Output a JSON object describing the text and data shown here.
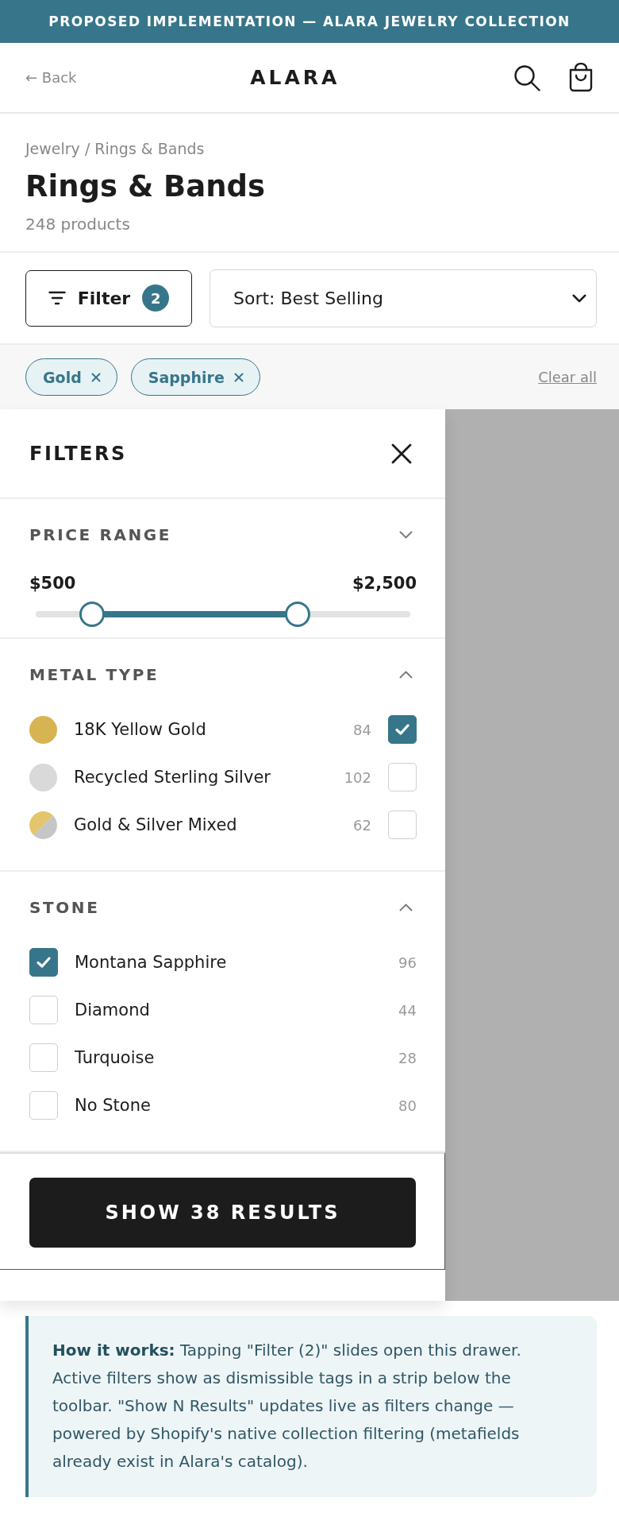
{
  "banner": {
    "text": "PROPOSED IMPLEMENTATION — ALARA JEWELRY COLLECTION"
  },
  "header": {
    "back": "← Back",
    "logo": "ALARA"
  },
  "collection": {
    "breadcrumb": "Jewelry / Rings & Bands",
    "title": "Rings & Bands",
    "count": "248 products"
  },
  "toolbar": {
    "filter_button": {
      "label": "Filter",
      "badge": "2"
    },
    "sort": {
      "value": "Sort: Best Selling"
    }
  },
  "active_filters": {
    "tags": [
      {
        "label": "Gold"
      },
      {
        "label": "Sapphire"
      }
    ],
    "clear_all": "Clear all"
  },
  "drawer": {
    "title": "FILTERS",
    "sections": [
      {
        "kind": "range",
        "title": "PRICE RANGE",
        "expanded": false,
        "min_label": "$500",
        "max_label": "$2,500",
        "thumbs": [
          {
            "level": 0.15
          },
          {
            "level": 0.7
          }
        ]
      },
      {
        "kind": "swatch_list",
        "title": "METAL TYPE",
        "expanded": true,
        "options": [
          {
            "label": "18K Yellow Gold",
            "count": "84",
            "checked": true,
            "swatch": [
              {
                "color": "#d6b452"
              }
            ]
          },
          {
            "label": "Recycled Sterling Silver",
            "count": "102",
            "checked": false,
            "swatch": [
              {
                "color": "#d9d9d9"
              }
            ]
          },
          {
            "label": "Gold & Silver Mixed",
            "count": "62",
            "checked": false,
            "swatch": [
              {
                "color": "#e3c56c"
              },
              {
                "color": "#c6c6c6"
              }
            ]
          }
        ]
      },
      {
        "kind": "checkbox_list",
        "title": "STONE",
        "expanded": true,
        "options": [
          {
            "label": "Montana Sapphire",
            "count": "96",
            "checked": true
          },
          {
            "label": "Diamond",
            "count": "44",
            "checked": false
          },
          {
            "label": "Turquoise",
            "count": "28",
            "checked": false
          },
          {
            "label": "No Stone",
            "count": "80",
            "checked": false
          }
        ]
      }
    ],
    "apply_button": "SHOW 38 RESULTS"
  },
  "note": {
    "text": "**How it works:** Tapping \"Filter (2)\" slides open this drawer. Active filters show as dismissible tags in a strip below the toolbar. \"Show N Results\" updates live as filters change — powered by Shopify's native collection filtering (metafields already exist in Alara's catalog)."
  }
}
